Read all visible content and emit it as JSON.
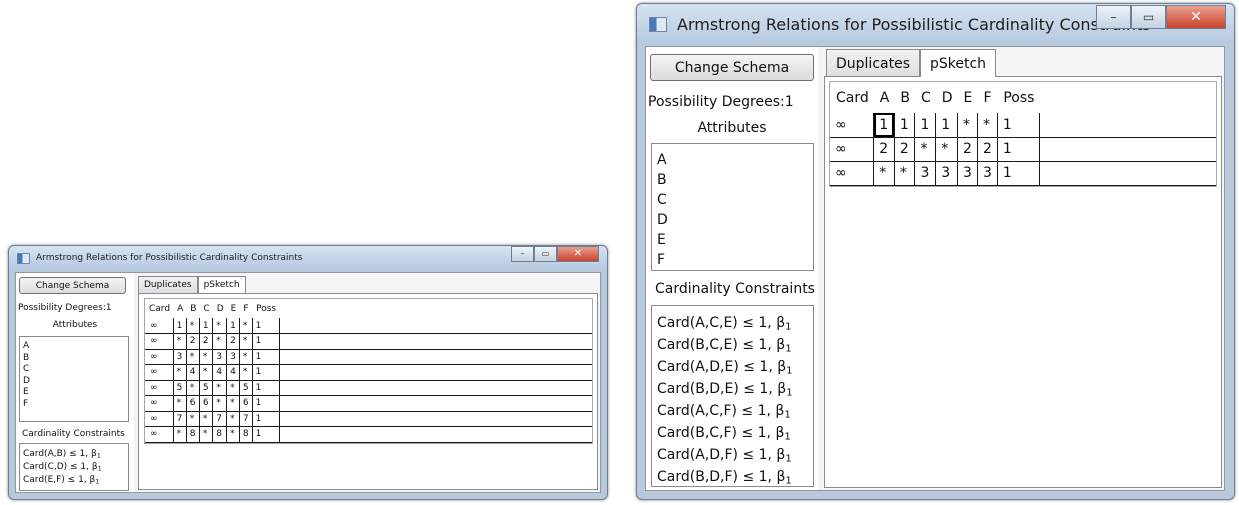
{
  "windows": [
    {
      "title": "Armstrong Relations for Possibilistic Cardinality Constraints",
      "window_buttons": {
        "minimize": "–",
        "maximize": "▭",
        "close": "✕"
      },
      "change_schema_label": "Change Schema",
      "possibility_degrees_label": "Possibility Degrees:1",
      "attributes_label": "Attributes",
      "attributes": [
        "A",
        "B",
        "C",
        "D",
        "E",
        "F"
      ],
      "cardinality_constraints_label": "Cardinality Constraints",
      "constraints": [
        {
          "text": "Card(A,B) ≤ 1, β",
          "sub": "1"
        },
        {
          "text": "Card(C,D) ≤ 1, β",
          "sub": "1"
        },
        {
          "text": "Card(E,F) ≤ 1, β",
          "sub": "1"
        }
      ],
      "tabs": [
        {
          "label": "Duplicates",
          "active": false
        },
        {
          "label": "pSketch",
          "active": true
        }
      ],
      "grid": {
        "columns": [
          "Card",
          "A",
          "B",
          "C",
          "D",
          "E",
          "F",
          "Poss"
        ],
        "rows": [
          [
            "∞",
            "1",
            "*",
            "1",
            "*",
            "1",
            "*",
            "1"
          ],
          [
            "∞",
            "*",
            "2",
            "2",
            "*",
            "2",
            "*",
            "1"
          ],
          [
            "∞",
            "3",
            "*",
            "*",
            "3",
            "3",
            "*",
            "1"
          ],
          [
            "∞",
            "*",
            "4",
            "*",
            "4",
            "4",
            "*",
            "1"
          ],
          [
            "∞",
            "5",
            "*",
            "5",
            "*",
            "*",
            "5",
            "1"
          ],
          [
            "∞",
            "*",
            "6",
            "6",
            "*",
            "*",
            "6",
            "1"
          ],
          [
            "∞",
            "7",
            "*",
            "*",
            "7",
            "*",
            "7",
            "1"
          ],
          [
            "∞",
            "*",
            "8",
            "*",
            "8",
            "*",
            "8",
            "1"
          ]
        ]
      }
    },
    {
      "title": "Armstrong Relations for Possibilistic Cardinality Constraints",
      "window_buttons": {
        "minimize": "–",
        "maximize": "▭",
        "close": "✕"
      },
      "change_schema_label": "Change Schema",
      "possibility_degrees_label": "Possibility Degrees:1",
      "attributes_label": "Attributes",
      "attributes": [
        "A",
        "B",
        "C",
        "D",
        "E",
        "F"
      ],
      "cardinality_constraints_label": "Cardinality Constraints",
      "constraints": [
        {
          "text": "Card(A,C,E) ≤ 1, β",
          "sub": "1"
        },
        {
          "text": "Card(B,C,E) ≤ 1, β",
          "sub": "1"
        },
        {
          "text": "Card(A,D,E) ≤ 1, β",
          "sub": "1"
        },
        {
          "text": "Card(B,D,E) ≤ 1, β",
          "sub": "1"
        },
        {
          "text": "Card(A,C,F) ≤ 1, β",
          "sub": "1"
        },
        {
          "text": "Card(B,C,F) ≤ 1, β",
          "sub": "1"
        },
        {
          "text": "Card(A,D,F) ≤ 1, β",
          "sub": "1"
        },
        {
          "text": "Card(B,D,F) ≤ 1, β",
          "sub": "1"
        }
      ],
      "tabs": [
        {
          "label": "Duplicates",
          "active": false
        },
        {
          "label": "pSketch",
          "active": true
        }
      ],
      "grid": {
        "columns": [
          "Card",
          "A",
          "B",
          "C",
          "D",
          "E",
          "F",
          "Poss"
        ],
        "rows": [
          [
            "∞",
            "1",
            "1",
            "1",
            "1",
            "*",
            "*",
            "1"
          ],
          [
            "∞",
            "2",
            "2",
            "*",
            "*",
            "2",
            "2",
            "1"
          ],
          [
            "∞",
            "*",
            "*",
            "3",
            "3",
            "3",
            "3",
            "1"
          ]
        ]
      }
    }
  ]
}
